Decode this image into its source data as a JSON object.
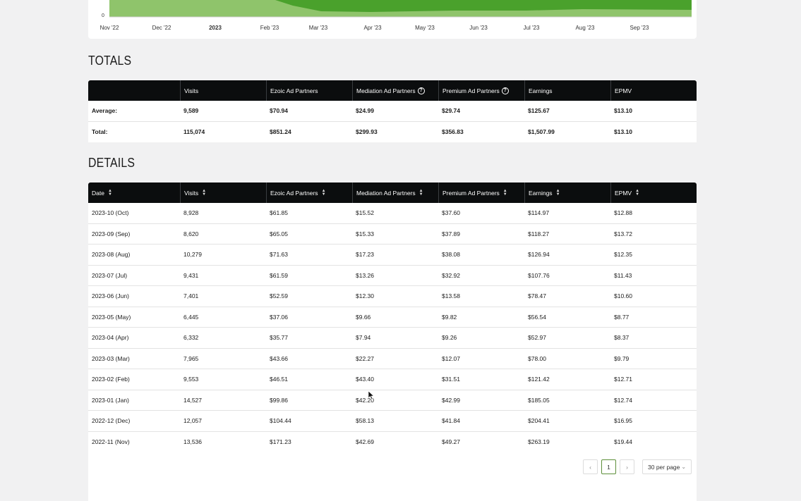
{
  "colors": {
    "area_light": "#8fc46b",
    "area_dark": "#4aa12c",
    "header_bg": "#0b0d0e",
    "pager_active": "#5d8f3a"
  },
  "chart": {
    "y_label": "0",
    "x_ticks": [
      {
        "label": "Nov '22",
        "bold": false
      },
      {
        "label": "Dec '22",
        "bold": false
      },
      {
        "label": "2023",
        "bold": true
      },
      {
        "label": "Feb '23",
        "bold": false
      },
      {
        "label": "Mar '23",
        "bold": false
      },
      {
        "label": "Apr '23",
        "bold": false
      },
      {
        "label": "May '23",
        "bold": false
      },
      {
        "label": "Jun '23",
        "bold": false
      },
      {
        "label": "Jul '23",
        "bold": false
      },
      {
        "label": "Aug '23",
        "bold": false
      },
      {
        "label": "Sep '23",
        "bold": false
      }
    ]
  },
  "totals": {
    "title": "TOTALS",
    "headers": [
      "",
      "Visits",
      "Ezoic Ad Partners",
      "Mediation Ad Partners",
      "Premium Ad Partners",
      "Earnings",
      "EPMV"
    ],
    "help_icon": "?",
    "rows": [
      [
        "Average:",
        "9,589",
        "$70.94",
        "$24.99",
        "$29.74",
        "$125.67",
        "$13.10"
      ],
      [
        "Total:",
        "115,074",
        "$851.24",
        "$299.93",
        "$356.83",
        "$1,507.99",
        "$13.10"
      ]
    ]
  },
  "details": {
    "title": "DETAILS",
    "headers": [
      "Date",
      "Visits",
      "Ezoic Ad Partners",
      "Mediation Ad Partners",
      "Premium Ad Partners",
      "Earnings",
      "EPMV"
    ],
    "rows": [
      [
        "2023-10 (Oct)",
        "8,928",
        "$61.85",
        "$15.52",
        "$37.60",
        "$114.97",
        "$12.88"
      ],
      [
        "2023-09 (Sep)",
        "8,620",
        "$65.05",
        "$15.33",
        "$37.89",
        "$118.27",
        "$13.72"
      ],
      [
        "2023-08 (Aug)",
        "10,279",
        "$71.63",
        "$17.23",
        "$38.08",
        "$126.94",
        "$12.35"
      ],
      [
        "2023-07 (Jul)",
        "9,431",
        "$61.59",
        "$13.26",
        "$32.92",
        "$107.76",
        "$11.43"
      ],
      [
        "2023-06 (Jun)",
        "7,401",
        "$52.59",
        "$12.30",
        "$13.58",
        "$78.47",
        "$10.60"
      ],
      [
        "2023-05 (May)",
        "6,445",
        "$37.06",
        "$9.66",
        "$9.82",
        "$56.54",
        "$8.77"
      ],
      [
        "2023-04 (Apr)",
        "6,332",
        "$35.77",
        "$7.94",
        "$9.26",
        "$52.97",
        "$8.37"
      ],
      [
        "2023-03 (Mar)",
        "7,965",
        "$43.66",
        "$22.27",
        "$12.07",
        "$78.00",
        "$9.79"
      ],
      [
        "2023-02 (Feb)",
        "9,553",
        "$46.51",
        "$43.40",
        "$31.51",
        "$121.42",
        "$12.71"
      ],
      [
        "2023-01 (Jan)",
        "14,527",
        "$99.86",
        "$42.20",
        "$42.99",
        "$185.05",
        "$12.74"
      ],
      [
        "2022-12 (Dec)",
        "12,057",
        "$104.44",
        "$58.13",
        "$41.84",
        "$204.41",
        "$16.95"
      ],
      [
        "2022-11 (Nov)",
        "13,536",
        "$171.23",
        "$42.69",
        "$49.27",
        "$263.19",
        "$19.44"
      ]
    ]
  },
  "pagination": {
    "prev": "‹",
    "current": "1",
    "next": "›",
    "per_page": "30 per page",
    "chevron": "⌄"
  }
}
